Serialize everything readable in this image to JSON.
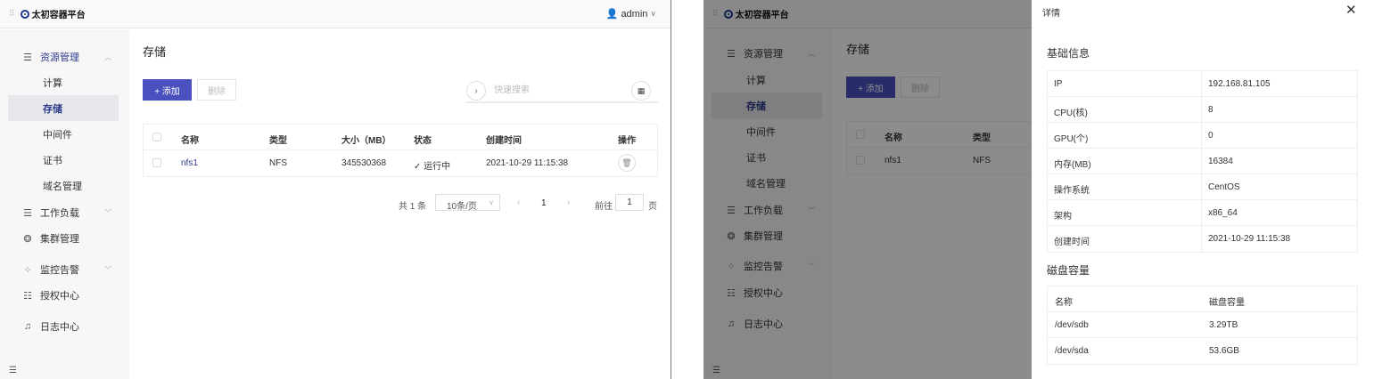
{
  "app": {
    "brand": "太初容器平台",
    "user": "admin"
  },
  "sidebar": {
    "resource": "资源管理",
    "resource_items": [
      "计算",
      "存储",
      "中间件",
      "证书",
      "域名管理"
    ],
    "workload": "工作负载",
    "cluster": "集群管理",
    "monitor": "监控告警",
    "auth": "授权中心",
    "log": "日志中心"
  },
  "page": {
    "title": "存储"
  },
  "toolbar": {
    "add_label": "+ 添加",
    "delete_label": "删除",
    "search_placeholder": "快速搜索"
  },
  "table": {
    "headers": [
      "名称",
      "类型",
      "大小（MB）",
      "状态",
      "创建时间",
      "操作"
    ],
    "rows": [
      {
        "name": "nfs1",
        "type": "NFS",
        "size": "345530368",
        "status": "✓ 运行中",
        "created": "2021-10-29 11:15:38"
      }
    ]
  },
  "pagination": {
    "total": "共 1 条",
    "page_size": "10条/页",
    "current": "1",
    "goto_label": "前往",
    "goto_value": "1",
    "page_unit": "页"
  },
  "drawer": {
    "title": "详情",
    "basic_title": "基础信息",
    "basic": [
      {
        "key": "IP",
        "value": "192.168.81.105"
      },
      {
        "key": "CPU(核)",
        "value": "8"
      },
      {
        "key": "GPU(个)",
        "value": "0"
      },
      {
        "key": "内存(MB)",
        "value": "16384"
      },
      {
        "key": "操作系统",
        "value": "CentOS"
      },
      {
        "key": "架构",
        "value": "x86_64"
      },
      {
        "key": "创建时间",
        "value": "2021-10-29 11:15:38"
      }
    ],
    "disk_title": "磁盘容量",
    "disk_headers": [
      "名称",
      "磁盘容量"
    ],
    "disks": [
      {
        "name": "/dev/sdb",
        "capacity": "3.29TB"
      },
      {
        "name": "/dev/sda",
        "capacity": "53.6GB"
      }
    ]
  },
  "colors": {
    "primary": "#4a50bd",
    "link": "#2d3a8c",
    "overlay": "rgba(0,0,0,0.45)"
  }
}
